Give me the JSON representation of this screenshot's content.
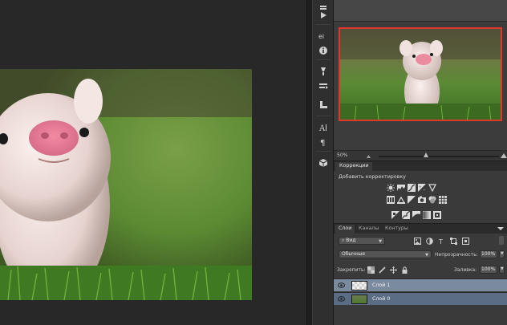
{
  "navigator": {
    "zoom": "50%"
  },
  "adjustments": {
    "tab_label": "Коррекции",
    "subtitle": "Добавить корректировку",
    "row1_icons": [
      "brightness-icon",
      "levels-icon",
      "curves-icon",
      "exposure-icon",
      "vibrance-icon"
    ],
    "row2_icons": [
      "hue-saturation-icon",
      "color-balance-icon",
      "black-white-icon",
      "photo-filter-icon",
      "channel-mixer-icon",
      "color-lookup-icon"
    ],
    "row3_icons": [
      "invert-icon",
      "posterize-icon",
      "threshold-icon",
      "gradient-map-icon",
      "selective-color-icon"
    ]
  },
  "layers": {
    "tabs": [
      {
        "label": "Слои"
      },
      {
        "label": "Каналы"
      },
      {
        "label": "Контуры"
      }
    ],
    "filter_kind": "Вид",
    "blend_mode": "Обычные",
    "opacity_label": "Непрозрачность:",
    "opacity_value": "100%",
    "lock_label": "Закрепить:",
    "fill_label": "Заливка:",
    "fill_value": "100%",
    "items": [
      {
        "name": "Слой 1",
        "selected": true
      },
      {
        "name": "Слой 0",
        "selected": false
      }
    ]
  },
  "colors": {
    "accent_red": "#e0372c",
    "selected_layer": "#7a8b9f",
    "layer_row": "#5a6d84"
  }
}
